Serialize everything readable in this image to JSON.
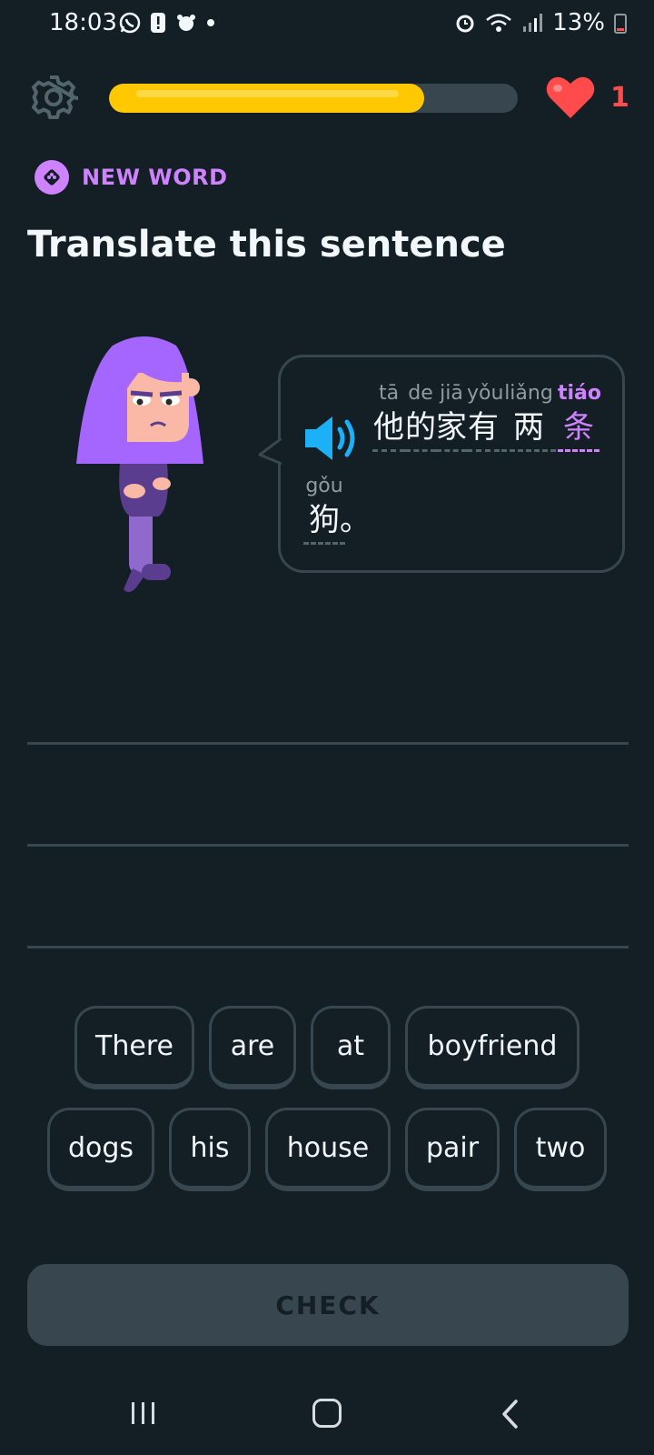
{
  "status_bar": {
    "time": "18:03",
    "battery": "13%"
  },
  "progress": {
    "fraction": 0.77,
    "color": "#ffc800"
  },
  "hearts": {
    "count": "1",
    "color": "#ff4b4b"
  },
  "lesson": {
    "badge_label": "NEW WORD",
    "title": "Translate this sentence"
  },
  "sentence": {
    "words": [
      {
        "pinyin": "tā",
        "hanzi": "他"
      },
      {
        "pinyin": "de",
        "hanzi": "的"
      },
      {
        "pinyin": "jiā",
        "hanzi": "家"
      },
      {
        "pinyin": "yǒu",
        "hanzi": "有"
      },
      {
        "pinyin": "liǎng",
        "hanzi": "两"
      },
      {
        "pinyin": "tiáo",
        "hanzi": "条",
        "new": true
      },
      {
        "pinyin": "gǒu",
        "hanzi": "狗"
      }
    ],
    "punctuation": "。"
  },
  "word_bank": {
    "row1": [
      "There",
      "are",
      "at",
      "boyfriend"
    ],
    "row2": [
      "dogs",
      "his",
      "house",
      "pair",
      "two"
    ]
  },
  "check_button": {
    "label": "CHECK"
  },
  "colors": {
    "accent_purple": "#ce82ff",
    "background": "#131f24",
    "border": "#37464f",
    "speaker_blue": "#1cb0f6"
  }
}
